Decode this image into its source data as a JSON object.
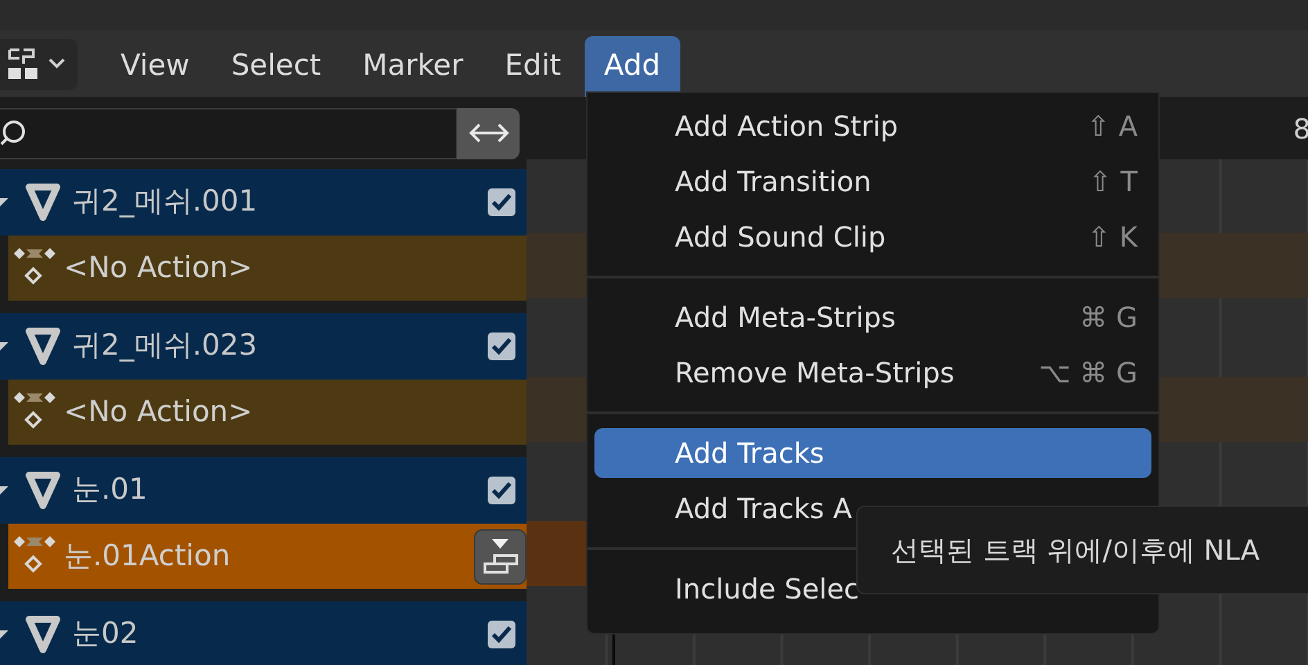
{
  "header": {
    "menus": [
      {
        "label": "View",
        "selected": false
      },
      {
        "label": "Select",
        "selected": false
      },
      {
        "label": "Marker",
        "selected": false
      },
      {
        "label": "Edit",
        "selected": false
      },
      {
        "label": "Add",
        "selected": true
      }
    ]
  },
  "channels": [
    {
      "kind": "object",
      "name": "귀2_메쉬.001",
      "checked": true
    },
    {
      "kind": "action",
      "name": "<No Action>",
      "active": false
    },
    {
      "kind": "object",
      "name": "귀2_메쉬.023",
      "checked": true
    },
    {
      "kind": "action",
      "name": "<No Action>",
      "active": false
    },
    {
      "kind": "object",
      "name": "눈.01",
      "checked": true
    },
    {
      "kind": "action",
      "name": "눈.01Action",
      "active": true
    },
    {
      "kind": "object",
      "name": "눈02",
      "checked": true
    }
  ],
  "timeline": {
    "ruler_label": "8"
  },
  "menu": {
    "items": [
      {
        "kind": "item",
        "label": "Add Action Strip",
        "shortcut": "⇧ A",
        "selected": false
      },
      {
        "kind": "item",
        "label": "Add Transition",
        "shortcut": "⇧ T",
        "selected": false
      },
      {
        "kind": "item",
        "label": "Add Sound Clip",
        "shortcut": "⇧ K",
        "selected": false
      },
      {
        "kind": "separator"
      },
      {
        "kind": "item",
        "label": "Add Meta-Strips",
        "shortcut": "⌘ G",
        "selected": false
      },
      {
        "kind": "item",
        "label": "Remove Meta-Strips",
        "shortcut": "⌥ ⌘ G",
        "selected": false
      },
      {
        "kind": "separator"
      },
      {
        "kind": "item",
        "label": "Add Tracks",
        "selected": true
      },
      {
        "kind": "item",
        "label": "Add Tracks A",
        "selected": false
      },
      {
        "kind": "separator"
      },
      {
        "kind": "item",
        "label": "Include Selec",
        "selected": false
      }
    ]
  },
  "tooltip": {
    "text": "선택된 트랙 위에/이후에 NLA"
  }
}
